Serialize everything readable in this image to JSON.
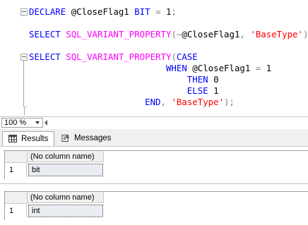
{
  "editor": {
    "lines": [
      [
        {
          "t": "DECLARE",
          "c": "kw"
        },
        {
          "t": " ",
          "c": "id"
        },
        {
          "t": "@CloseFlag1",
          "c": "id"
        },
        {
          "t": " ",
          "c": "id"
        },
        {
          "t": "BIT",
          "c": "kw"
        },
        {
          "t": " ",
          "c": "id"
        },
        {
          "t": "=",
          "c": "op"
        },
        {
          "t": " ",
          "c": "id"
        },
        {
          "t": "1",
          "c": "num"
        },
        {
          "t": ";",
          "c": "op"
        }
      ],
      [],
      [
        {
          "t": "SELECT",
          "c": "kw"
        },
        {
          "t": " ",
          "c": "id"
        },
        {
          "t": "SQL_VARIANT_PROPERTY",
          "c": "fn"
        },
        {
          "t": "(",
          "c": "op"
        },
        {
          "t": "~",
          "c": "op"
        },
        {
          "t": "@CloseFlag1",
          "c": "id"
        },
        {
          "t": ", ",
          "c": "op"
        },
        {
          "t": "'BaseType'",
          "c": "str"
        },
        {
          "t": ");",
          "c": "op"
        }
      ],
      [],
      [
        {
          "t": "SELECT",
          "c": "kw"
        },
        {
          "t": " ",
          "c": "id"
        },
        {
          "t": "SQL_VARIANT_PROPERTY",
          "c": "fn"
        },
        {
          "t": "(",
          "c": "op"
        },
        {
          "t": "CASE",
          "c": "kw"
        }
      ],
      [
        {
          "t": "                          ",
          "c": "id"
        },
        {
          "t": "WHEN",
          "c": "kw"
        },
        {
          "t": " ",
          "c": "id"
        },
        {
          "t": "@CloseFlag1",
          "c": "id"
        },
        {
          "t": " ",
          "c": "id"
        },
        {
          "t": "=",
          "c": "op"
        },
        {
          "t": " ",
          "c": "id"
        },
        {
          "t": "1",
          "c": "num"
        }
      ],
      [
        {
          "t": "                              ",
          "c": "id"
        },
        {
          "t": "THEN",
          "c": "kw"
        },
        {
          "t": " ",
          "c": "id"
        },
        {
          "t": "0",
          "c": "num"
        }
      ],
      [
        {
          "t": "                              ",
          "c": "id"
        },
        {
          "t": "ELSE",
          "c": "kw"
        },
        {
          "t": " ",
          "c": "id"
        },
        {
          "t": "1",
          "c": "num"
        }
      ],
      [
        {
          "t": "                      ",
          "c": "id"
        },
        {
          "t": "END",
          "c": "kw"
        },
        {
          "t": ", ",
          "c": "op"
        },
        {
          "t": "'BaseType'",
          "c": "str"
        },
        {
          "t": ");",
          "c": "op"
        }
      ]
    ]
  },
  "zoom": {
    "value": "100 %"
  },
  "tabs": {
    "results": "Results",
    "messages": "Messages"
  },
  "grids": [
    {
      "column_header": "(No column name)",
      "row_number": "1",
      "cell": "bit"
    },
    {
      "column_header": "(No column name)",
      "row_number": "1",
      "cell": "int"
    }
  ]
}
